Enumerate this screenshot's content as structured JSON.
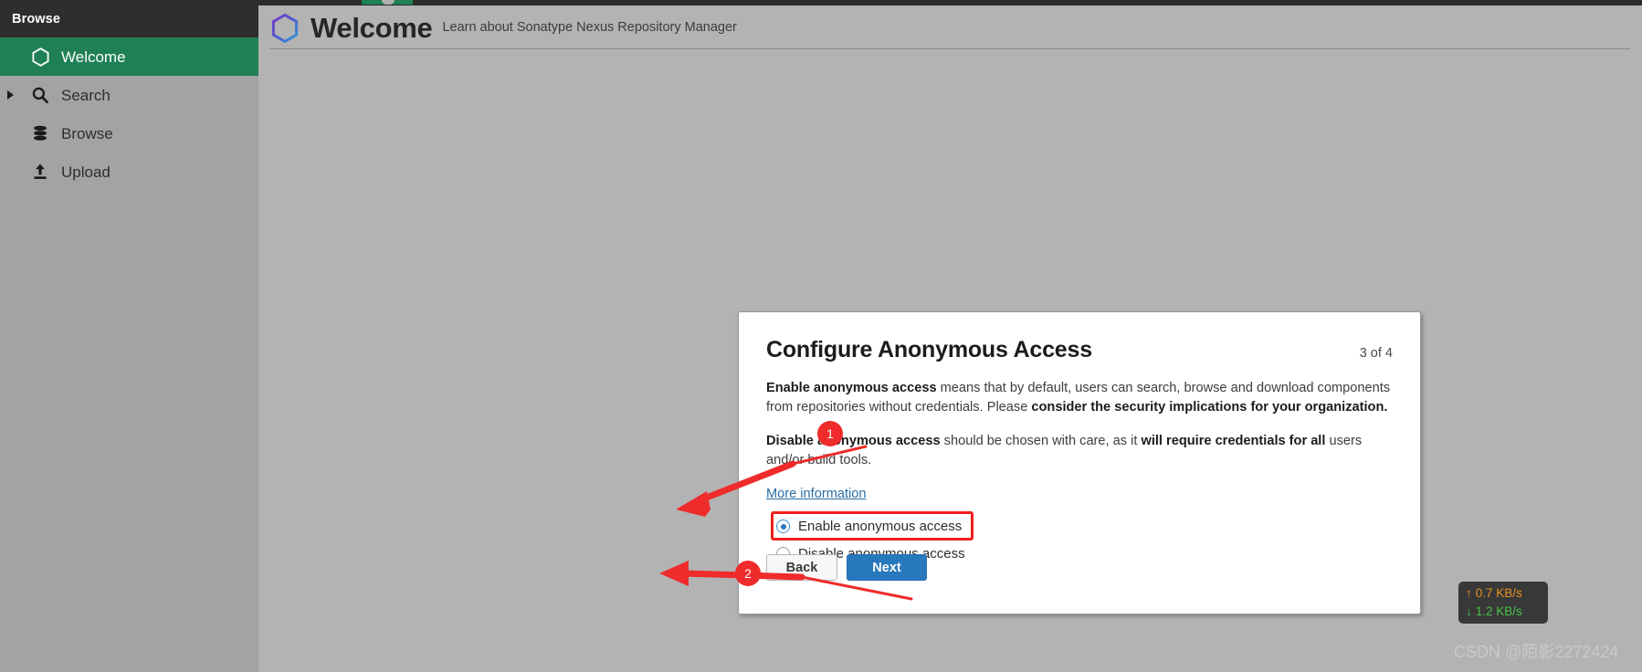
{
  "window": {
    "top_tab_color": "#1f8055"
  },
  "sidebar": {
    "header_label": "Browse",
    "items": [
      {
        "label": "Welcome",
        "icon": "hexagon-icon",
        "active": true,
        "expander": false
      },
      {
        "label": "Search",
        "icon": "search-icon",
        "active": false,
        "expander": true
      },
      {
        "label": "Browse",
        "icon": "database-icon",
        "active": false,
        "expander": false
      },
      {
        "label": "Upload",
        "icon": "upload-icon",
        "active": false,
        "expander": false
      }
    ],
    "active_color": "#1f8055",
    "bg_color": "#a3a3a3",
    "header_bg": "#2e2e2e"
  },
  "header": {
    "logo_icon": "hexagon-logo-icon",
    "title": "Welcome",
    "subtitle": "Learn about Sonatype Nexus Repository Manager"
  },
  "dialog": {
    "title": "Configure Anonymous Access",
    "step": "3 of 4",
    "paragraph1": {
      "bold_lead": "Enable anonymous access",
      "text_a": " means that by default, users can search, browse and download components from repositories without credentials. Please ",
      "bold_mid": "consider the security implications for your organization.",
      "text_b": ""
    },
    "paragraph2": {
      "bold_lead": "Disable anonymous access",
      "text_a": " should be chosen with care, as it ",
      "bold_mid": "will require credentials for all",
      "text_b": " users and/or build tools."
    },
    "more_info_link": "More information",
    "radios": [
      {
        "label": "Enable anonymous access",
        "checked": true,
        "highlighted": true
      },
      {
        "label": "Disable anonymous access",
        "checked": false,
        "highlighted": false
      }
    ],
    "buttons": {
      "back_label": "Back",
      "next_label": "Next",
      "primary_color": "#2878bd"
    }
  },
  "annotations": {
    "color": "#ef2b2b",
    "markers": [
      {
        "number": "1",
        "target": "enable-anonymous-access-radio"
      },
      {
        "number": "2",
        "target": "next-button"
      }
    ]
  },
  "network_widget": {
    "upload": "0.7 KB/s",
    "download": "1.2 KB/s",
    "up_arrow": "↑",
    "down_arrow": "↓",
    "up_color": "#e8921e",
    "down_color": "#49c24a"
  },
  "watermark": {
    "text": "CSDN @陌影2272424"
  }
}
